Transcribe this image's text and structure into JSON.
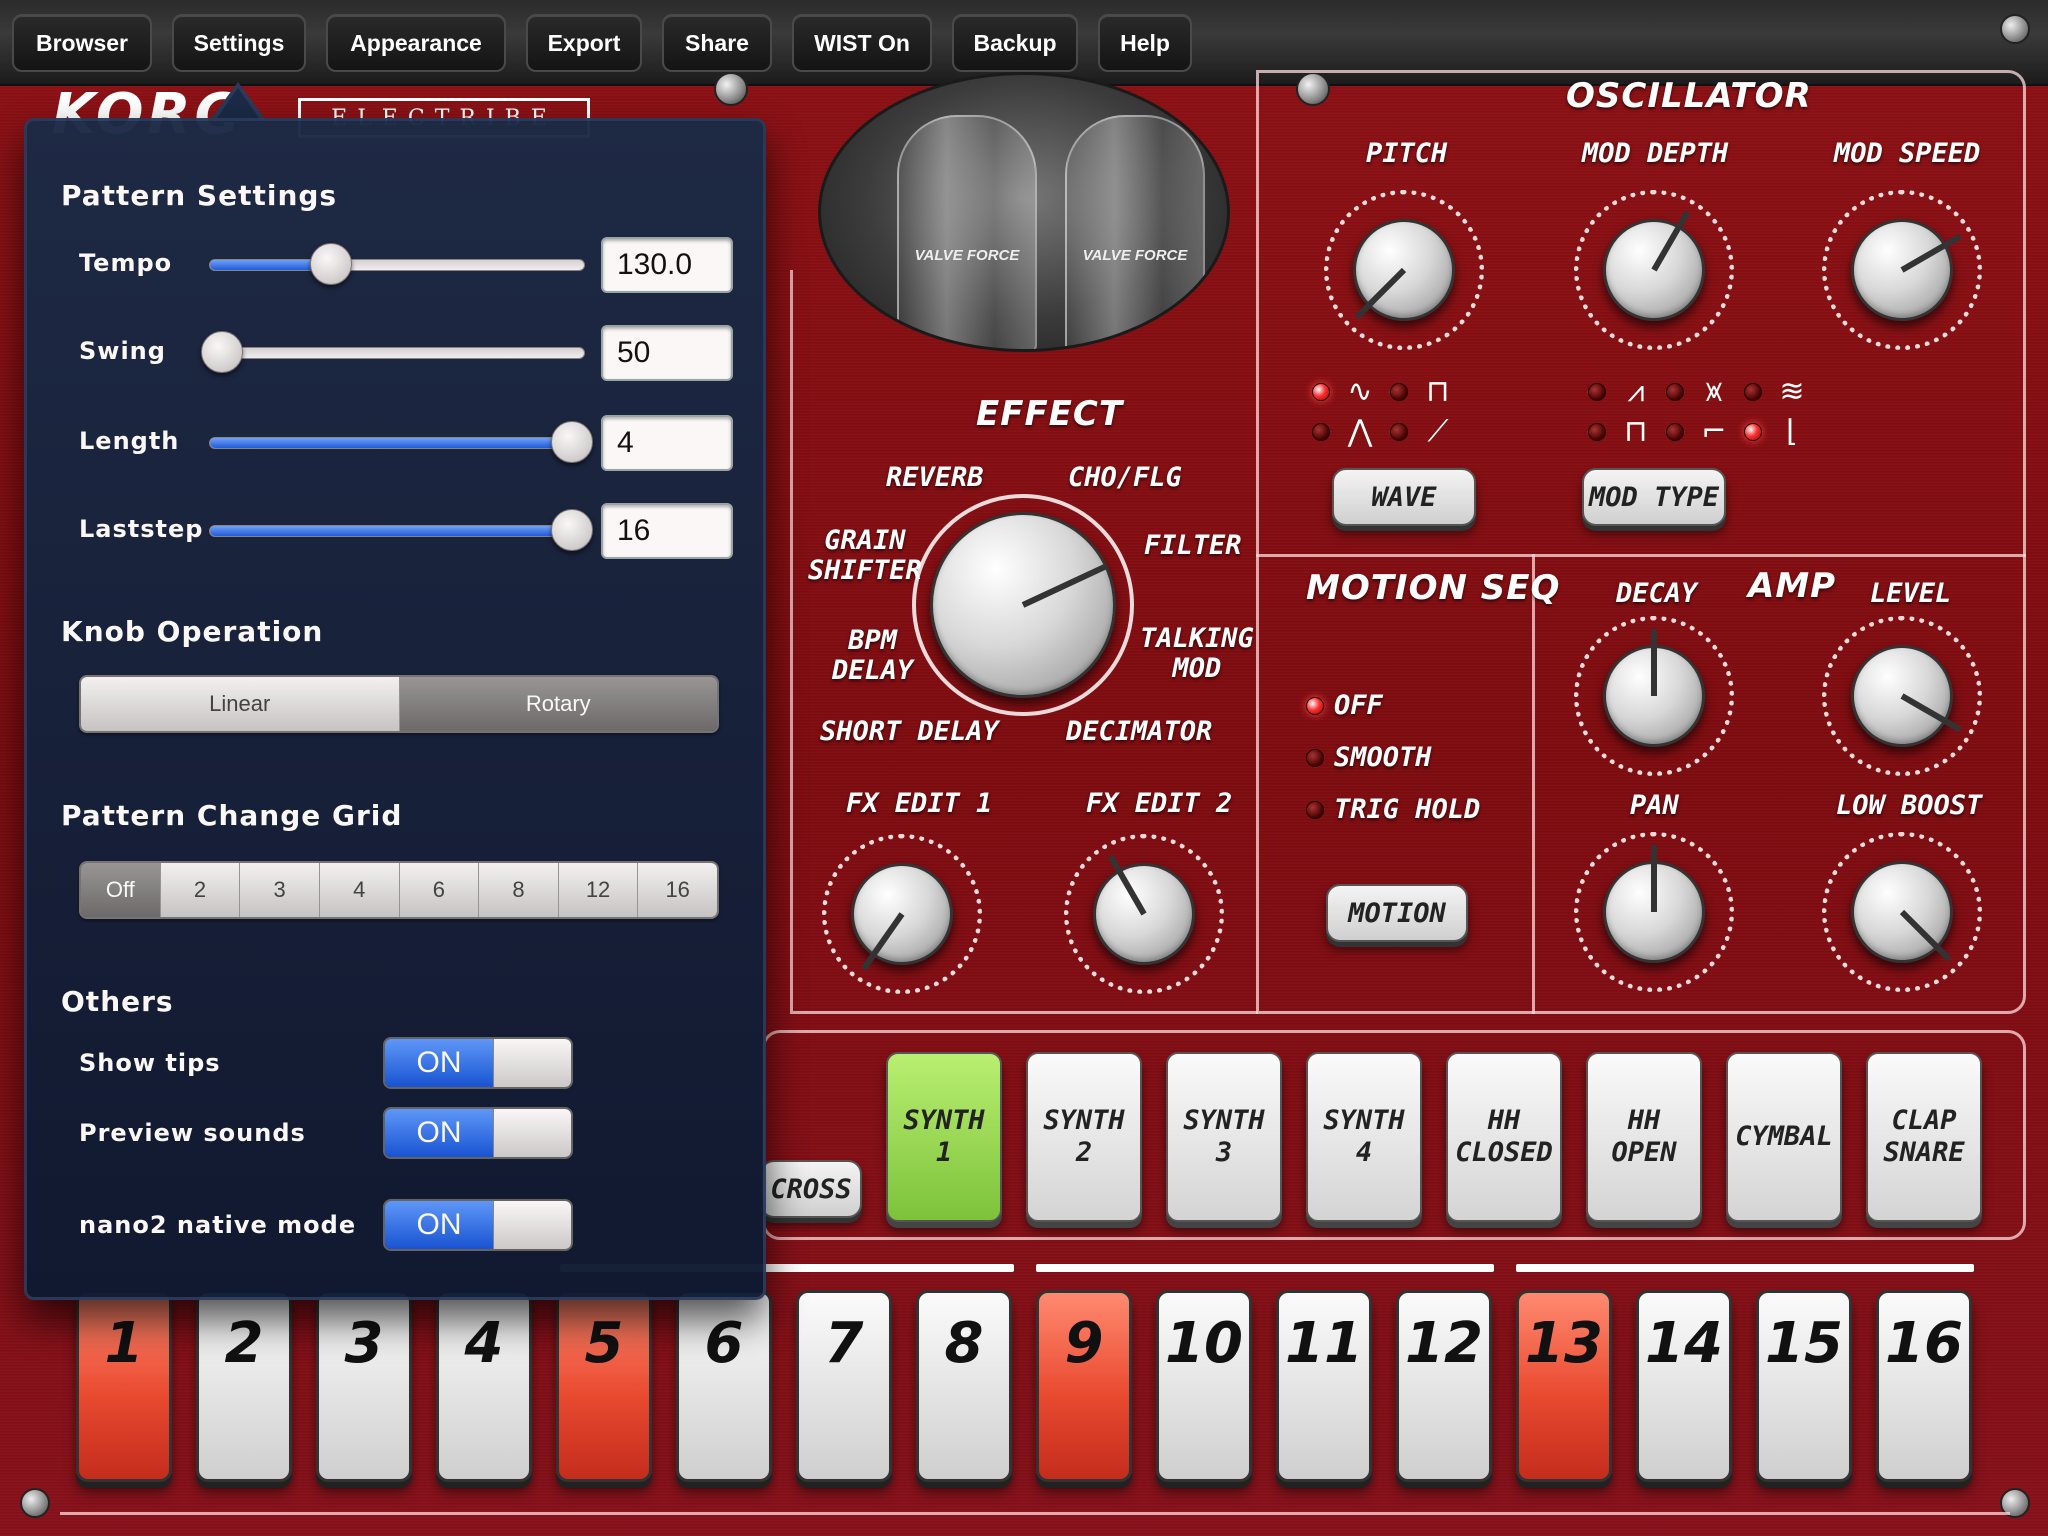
{
  "menu": [
    "Browser",
    "Settings",
    "Appearance",
    "Export",
    "Share",
    "WIST On",
    "Backup",
    "Help"
  ],
  "brand": {
    "logo": "KORG",
    "product": "ELECTRIBE"
  },
  "tubes": {
    "label": "VALVE FORCE"
  },
  "oscillator": {
    "title": "OSCILLATOR",
    "knobs": [
      "PITCH",
      "MOD DEPTH",
      "MOD SPEED"
    ],
    "wave_button": "WAVE",
    "mod_type_button": "MOD TYPE"
  },
  "effect": {
    "title": "EFFECT",
    "types": {
      "reverb": "REVERB",
      "choflg": "CHO/FLG",
      "grain": "GRAIN\nSHIFTER",
      "filter": "FILTER",
      "bpm": "BPM\nDELAY",
      "talking": "TALKING\nMOD",
      "short": "SHORT DELAY",
      "decimator": "DECIMATOR"
    },
    "fx_edit_1": "FX EDIT 1",
    "fx_edit_2": "FX EDIT 2"
  },
  "motion": {
    "title": "MOTION SEQ",
    "options": [
      "OFF",
      "SMOOTH",
      "TRIG HOLD"
    ],
    "selected": "OFF",
    "button": "MOTION"
  },
  "amp": {
    "title": "AMP",
    "knobs": [
      "DECAY",
      "LEVEL",
      "PAN",
      "LOW BOOST"
    ]
  },
  "instruments": {
    "cross": "CROSS",
    "parts": [
      "SYNTH\n1",
      "SYNTH\n2",
      "SYNTH\n3",
      "SYNTH\n4",
      "HH\nCLOSED",
      "HH\nOPEN",
      "CYMBAL",
      "CLAP\nSNARE"
    ],
    "active": "SYNTH 1"
  },
  "steps": {
    "labels": [
      "1",
      "2",
      "3",
      "4",
      "5",
      "6",
      "7",
      "8",
      "9",
      "10",
      "11",
      "12",
      "13",
      "14",
      "15",
      "16"
    ],
    "lit": [
      1,
      5,
      9,
      13
    ]
  },
  "settings": {
    "pattern_settings_title": "Pattern Settings",
    "tempo": {
      "label": "Tempo",
      "value": "130.0",
      "fraction": 0.31
    },
    "swing": {
      "label": "Swing",
      "value": "50",
      "fraction": 0.0
    },
    "length": {
      "label": "Length",
      "value": "4",
      "fraction": 1.0
    },
    "laststep": {
      "label": "Laststep",
      "value": "16",
      "fraction": 1.0
    },
    "knob_operation_title": "Knob Operation",
    "knob_operation": {
      "options": [
        "Linear",
        "Rotary"
      ],
      "selected": "Rotary"
    },
    "grid_title": "Pattern Change Grid",
    "grid": {
      "options": [
        "Off",
        "2",
        "3",
        "4",
        "6",
        "8",
        "12",
        "16"
      ],
      "selected": "Off"
    },
    "others_title": "Others",
    "others": [
      {
        "label": "Show tips",
        "state": "ON"
      },
      {
        "label": "Preview sounds",
        "state": "ON"
      },
      {
        "label": "nano2 native mode",
        "state": "ON"
      }
    ]
  }
}
